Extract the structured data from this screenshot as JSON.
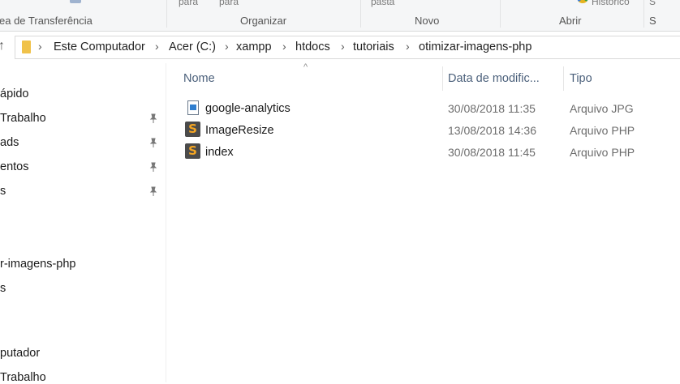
{
  "ribbon": {
    "clipboard_label": "ea de Transferência",
    "organize_label": "Organizar",
    "organize_small_1": "para",
    "organize_small_2": "para",
    "new_label": "Novo",
    "new_small": "pasta",
    "open_label": "Abrir",
    "open_small": "Histórico",
    "select_small": "S"
  },
  "address": {
    "crumbs": [
      "Este Computador",
      "Acer (C:)",
      "xampp",
      "htdocs",
      "tutoriais",
      "otimizar-imagens-php"
    ]
  },
  "navpane": {
    "items": [
      {
        "label": "ápido"
      },
      {
        "label": " Trabalho",
        "pinned": true
      },
      {
        "label": "ads",
        "pinned": true
      },
      {
        "label": "entos",
        "pinned": true
      },
      {
        "label": "s",
        "pinned": true
      },
      {
        "label": "r-imagens-php"
      },
      {
        "label": "s"
      },
      {
        "label": ""
      },
      {
        "label": "putador"
      },
      {
        "label": " Trabalho"
      }
    ]
  },
  "filelist": {
    "columns": [
      "Nome",
      "Data de modific...",
      "Tipo"
    ],
    "rows": [
      {
        "name": "google-analytics",
        "date": "30/08/2018 11:35",
        "type": "Arquivo JPG",
        "icon": "jpg-file-icon"
      },
      {
        "name": "ImageResize",
        "date": "13/08/2018 14:36",
        "type": "Arquivo PHP",
        "icon": "sublime-php-icon"
      },
      {
        "name": "index",
        "date": "30/08/2018 11:45",
        "type": "Arquivo PHP",
        "icon": "sublime-php-icon"
      }
    ]
  },
  "colors": {
    "header_text": "#4a5f7a",
    "folder": "#f0c24a",
    "sublime_bg": "#4b4b4b",
    "sublime_s": "#f5a623"
  }
}
